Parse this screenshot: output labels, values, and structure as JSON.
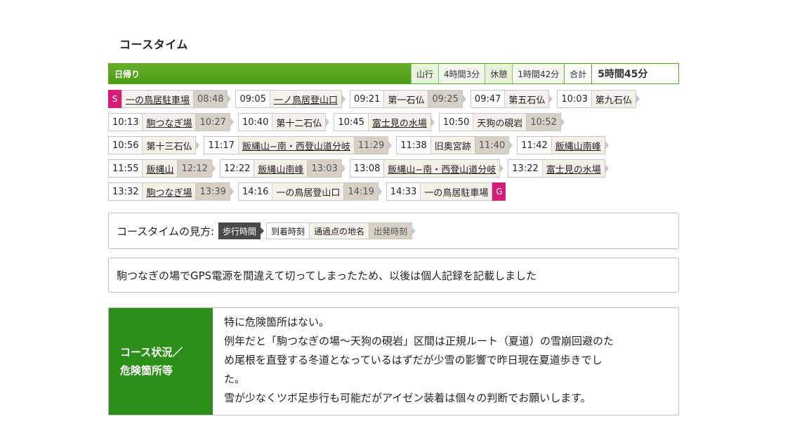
{
  "title": "コースタイム",
  "summary": {
    "trip_type": "日帰り",
    "walk_label": "山行",
    "walk_value": "4時間3分",
    "rest_label": "休憩",
    "rest_value": "1時間42分",
    "total_label": "合計",
    "total_value": "5時間45分"
  },
  "route": {
    "start_badge": "S",
    "goal_badge": "G",
    "rows": [
      [
        {
          "arrive": "",
          "place": "一の鳥居駐車場",
          "depart": "08:48",
          "start": true
        },
        {
          "arrive": "09:05",
          "place": "一ノ鳥居登山口",
          "depart": "",
          "link": true
        },
        {
          "arrive": "09:21",
          "place": "第一石仏",
          "depart": "09:25"
        },
        {
          "arrive": "09:47",
          "place": "第五石仏",
          "depart": ""
        },
        {
          "arrive": "10:03",
          "place": "第九石仏",
          "depart": ""
        }
      ],
      [
        {
          "arrive": "10:13",
          "place": "駒つなぎ場",
          "depart": "10:27",
          "link": true
        },
        {
          "arrive": "10:40",
          "place": "第十二石仏",
          "depart": ""
        },
        {
          "arrive": "10:45",
          "place": "富士見の水場",
          "depart": "",
          "link": true
        },
        {
          "arrive": "10:50",
          "place": "天狗の硯岩",
          "depart": "10:52"
        }
      ],
      [
        {
          "arrive": "10:56",
          "place": "第十三石仏",
          "depart": ""
        },
        {
          "arrive": "11:17",
          "place": "飯縄山−南・西登山道分岐",
          "depart": "11:29",
          "link": true
        },
        {
          "arrive": "11:38",
          "place": "旧奥宮跡",
          "depart": "11:40"
        },
        {
          "arrive": "11:42",
          "place": "飯縄山南峰",
          "depart": "",
          "link": true
        }
      ],
      [
        {
          "arrive": "11:55",
          "place": "飯縄山",
          "depart": "12:12",
          "link": true
        },
        {
          "arrive": "12:22",
          "place": "飯縄山南峰",
          "depart": "13:03",
          "link": true
        },
        {
          "arrive": "13:08",
          "place": "飯縄山−南・西登山道分岐",
          "depart": "",
          "link": true
        },
        {
          "arrive": "13:22",
          "place": "富士見の水場",
          "depart": "",
          "link": true
        }
      ],
      [
        {
          "arrive": "13:32",
          "place": "駒つなぎ場",
          "depart": "13:39",
          "link": true
        },
        {
          "arrive": "14:16",
          "place": "一の鳥居登山口",
          "depart": "14:19"
        },
        {
          "arrive": "14:33",
          "place": "一の鳥居駐車場",
          "depart": "",
          "goal": true
        }
      ]
    ]
  },
  "howto": {
    "label": "コースタイムの見方:",
    "walk": "歩行時間",
    "arrive": "到着時刻",
    "place": "通過点の地名",
    "depart": "出発時刻"
  },
  "note": "駒つなぎの場でGPS電源を間違えて切ってしまったため、以後は個人記録を記載しました",
  "conditions": {
    "heading_line1": "コース状況／",
    "heading_line2": "危険箇所等",
    "lines": [
      "特に危険箇所はない。",
      "例年だと「駒つなぎの場〜天狗の硯岩」区間は正規ルート（夏道）の雪崩回避のた",
      "め尾根を直登する冬道となっているはずだが少雪の影響で昨日現在夏道歩きでし",
      "た。",
      "雪が少なくツボ足歩行も可能だがアイゼン装着は個々の判断でお願いします。"
    ]
  }
}
